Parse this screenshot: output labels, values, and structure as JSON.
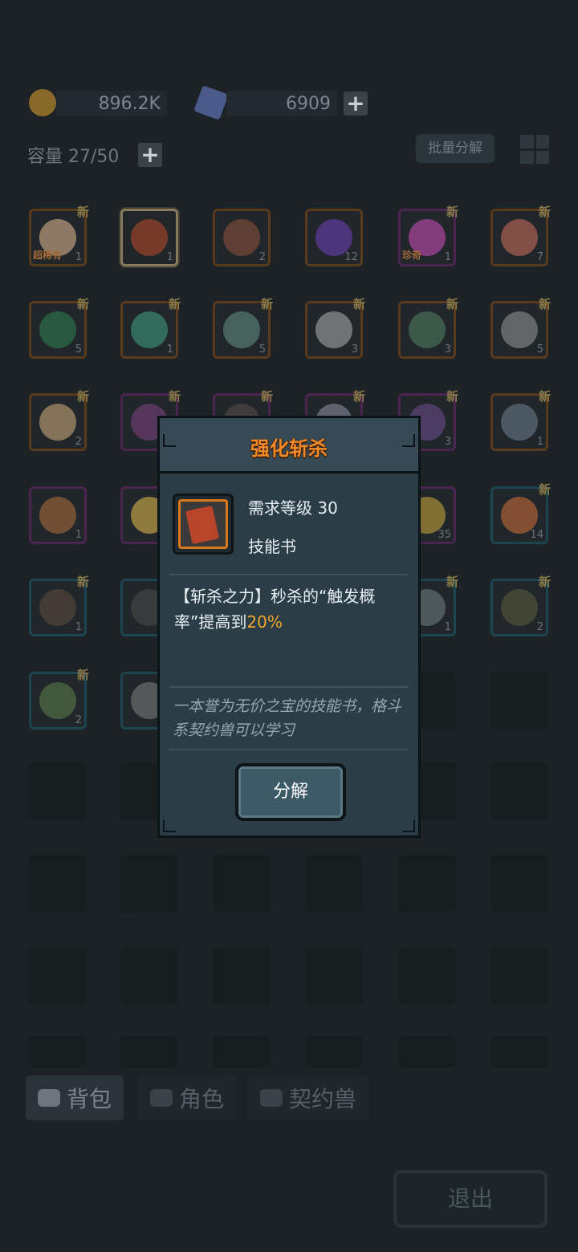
{
  "resources": {
    "gold": "896.2K",
    "crystal": "6909"
  },
  "capacity_label": "容量 27/50",
  "batch_decompose_label": "批量分解",
  "new_tag": "新",
  "inventory_rows": [
    [
      {
        "q": "1",
        "n": true,
        "c": "orange",
        "label": "超稀有",
        "art": "#d9b38c"
      },
      {
        "q": "1",
        "n": false,
        "c": "orange",
        "sel": true,
        "art": "#b34a2a"
      },
      {
        "q": "2",
        "n": false,
        "c": "orange",
        "art": "#8a4e3a"
      },
      {
        "q": "12",
        "n": false,
        "c": "orange",
        "art": "#6b3fb3"
      },
      {
        "q": "1",
        "n": true,
        "c": "purple",
        "label": "珍奇",
        "art": "#c44ab3"
      },
      {
        "q": "7",
        "n": true,
        "c": "orange",
        "art": "#c46a5a"
      }
    ],
    [
      {
        "q": "5",
        "n": true,
        "c": "orange",
        "art": "#2f7a4f"
      },
      {
        "q": "1",
        "n": true,
        "c": "orange",
        "art": "#3f9a7f"
      },
      {
        "q": "5",
        "n": true,
        "c": "orange",
        "art": "#5f8a7f"
      },
      {
        "q": "3",
        "n": true,
        "c": "orange",
        "art": "#a7a7a7"
      },
      {
        "q": "3",
        "n": true,
        "c": "orange",
        "art": "#4f7a5f"
      },
      {
        "q": "5",
        "n": true,
        "c": "orange",
        "art": "#8f8f8f"
      }
    ],
    [
      {
        "q": "2",
        "n": true,
        "c": "orange",
        "art": "#c9a67a"
      },
      {
        "q": "",
        "n": true,
        "c": "purple",
        "art": "#7a3f7a"
      },
      {
        "q": "",
        "n": true,
        "c": "purple",
        "art": "#5a4a4a"
      },
      {
        "q": "",
        "n": true,
        "c": "purple",
        "art": "#8a8a9a"
      },
      {
        "q": "3",
        "n": true,
        "c": "purple",
        "art": "#6a4a8a"
      },
      {
        "q": "1",
        "n": true,
        "c": "orange",
        "art": "#6a7a8a"
      }
    ],
    [
      {
        "q": "1",
        "n": false,
        "c": "purple",
        "art": "#a86a3a"
      },
      {
        "q": "",
        "n": false,
        "c": "purple",
        "art": "#d9b34a"
      },
      {
        "q": "",
        "n": false,
        "c": "purple",
        "art": "#5a5a5a"
      },
      {
        "q": "",
        "n": false,
        "c": "purple",
        "art": "#5a5a5a"
      },
      {
        "q": "35",
        "n": false,
        "c": "purple",
        "art": "#c4a03a"
      },
      {
        "q": "14",
        "n": true,
        "c": "teal",
        "art": "#c46a3a"
      }
    ],
    [
      {
        "q": "1",
        "n": true,
        "c": "teal",
        "art": "#5a4a3a"
      },
      {
        "q": "",
        "n": false,
        "c": "teal",
        "art": "#4a4a4a"
      },
      {
        "q": "",
        "n": false,
        "c": "teal",
        "art": "#4a4a4a"
      },
      {
        "q": "",
        "n": false,
        "c": "teal",
        "art": "#4a4a4a"
      },
      {
        "q": "1",
        "n": true,
        "c": "teal",
        "art": "#6a7a7a"
      },
      {
        "q": "2",
        "n": true,
        "c": "teal",
        "art": "#5a5a3a"
      }
    ],
    [
      {
        "q": "2",
        "n": true,
        "c": "teal",
        "art": "#5a7a4a"
      },
      {
        "q": "",
        "n": false,
        "c": "teal",
        "art": "#7a7a7a"
      },
      {
        "q": "",
        "n": false,
        "c": "empty"
      },
      {
        "q": "",
        "n": false,
        "c": "empty"
      },
      {
        "q": "",
        "n": false,
        "c": "empty"
      },
      {
        "q": "",
        "n": false,
        "c": "empty"
      }
    ]
  ],
  "tabs": [
    {
      "label": "背包",
      "icon": "bag-icon",
      "active": true
    },
    {
      "label": "角色",
      "icon": "character-icon",
      "active": false
    },
    {
      "label": "契约兽",
      "icon": "paw-icon",
      "active": false
    }
  ],
  "exit_label": "退出",
  "popup": {
    "title": "强化斩杀",
    "required_level": "需求等级 30",
    "item_type": "技能书",
    "desc_prefix": "【斩杀之力】秒杀的“触发概率”提高到",
    "desc_highlight": "20%",
    "flavor": "一本誉为无价之宝的技能书，格斗系契约兽可以学习",
    "decompose_label": "分解"
  }
}
